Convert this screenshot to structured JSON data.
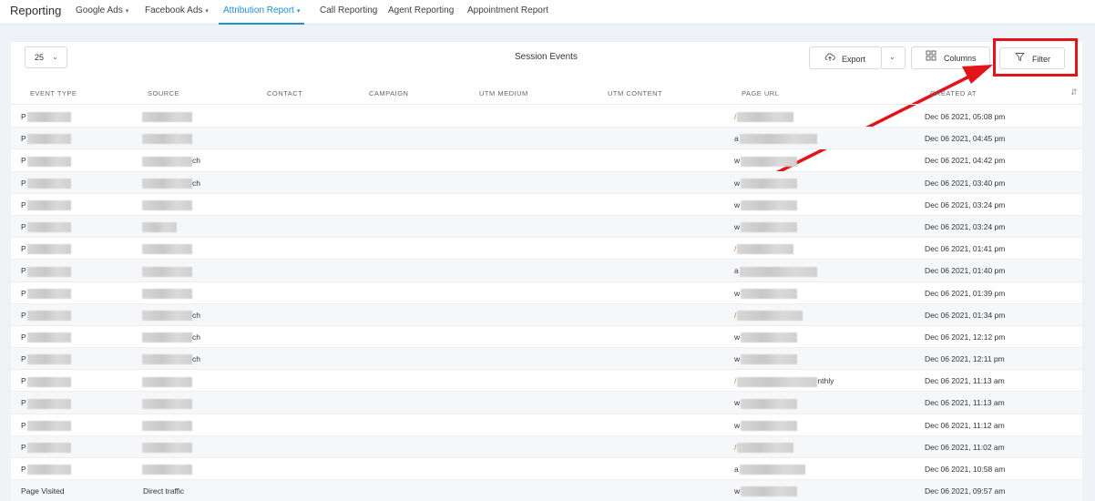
{
  "nav": {
    "title": "Reporting",
    "items": [
      {
        "label": "Google Ads",
        "chevron": "▾"
      },
      {
        "label": "Facebook Ads",
        "chevron": "▾"
      },
      {
        "label": "Attribution Report",
        "chevron": "▾"
      },
      {
        "label": "Call Reporting"
      },
      {
        "label": "Agent Reporting"
      },
      {
        "label": "Appointment Report"
      }
    ]
  },
  "toolbar": {
    "page_size": "25",
    "title": "Session Events",
    "export_label": "Export",
    "columns_label": "Columns",
    "filter_label": "Filter"
  },
  "table": {
    "columns": [
      "EVENT TYPE",
      "SOURCE",
      "CONTACT",
      "CAMPAIGN",
      "UTM MEDIUM",
      "UTM CONTENT",
      "PAGE URL",
      "CREATED AT"
    ],
    "rows": [
      {
        "type_prefix": "P",
        "src_suffix": "",
        "url_prefix": "/",
        "url_suffix": "",
        "created": "Dec 06 2021, 05:08 pm"
      },
      {
        "type_prefix": "P",
        "src_suffix": "",
        "url_prefix": "a",
        "url_suffix": "",
        "created": "Dec 06 2021, 04:45 pm"
      },
      {
        "type_prefix": "P",
        "src_suffix": "ch",
        "url_prefix": "w",
        "url_suffix": "",
        "created": "Dec 06 2021, 04:42 pm"
      },
      {
        "type_prefix": "P",
        "src_suffix": "ch",
        "url_prefix": "w",
        "url_suffix": "",
        "created": "Dec 06 2021, 03:40 pm"
      },
      {
        "type_prefix": "P",
        "src_suffix": "",
        "url_prefix": "w",
        "url_suffix": "",
        "created": "Dec 06 2021, 03:24 pm"
      },
      {
        "type_prefix": "P",
        "src_suffix": "",
        "url_prefix": "w",
        "url_suffix": "",
        "created": "Dec 06 2021, 03:24 pm"
      },
      {
        "type_prefix": "P",
        "src_suffix": "",
        "url_prefix": "/",
        "url_suffix": "",
        "created": "Dec 06 2021, 01:41 pm"
      },
      {
        "type_prefix": "P",
        "src_suffix": "",
        "url_prefix": "a",
        "url_suffix": "",
        "created": "Dec 06 2021, 01:40 pm"
      },
      {
        "type_prefix": "P",
        "src_suffix": "",
        "url_prefix": "w",
        "url_suffix": "",
        "created": "Dec 06 2021, 01:39 pm"
      },
      {
        "type_prefix": "P",
        "src_suffix": "ch",
        "url_prefix": "/",
        "url_suffix": "",
        "created": "Dec 06 2021, 01:34 pm"
      },
      {
        "type_prefix": "P",
        "src_suffix": "ch",
        "url_prefix": "w",
        "url_suffix": "",
        "created": "Dec 06 2021, 12:12 pm"
      },
      {
        "type_prefix": "P",
        "src_suffix": "ch",
        "url_prefix": "w",
        "url_suffix": "",
        "created": "Dec 06 2021, 12:11 pm"
      },
      {
        "type_prefix": "P",
        "src_suffix": "",
        "url_prefix": "/",
        "url_suffix": "nthly",
        "created": "Dec 06 2021, 11:13 am"
      },
      {
        "type_prefix": "P",
        "src_suffix": "",
        "url_prefix": "w",
        "url_suffix": "",
        "created": "Dec 06 2021, 11:13 am"
      },
      {
        "type_prefix": "P",
        "src_suffix": "",
        "url_prefix": "w",
        "url_suffix": "",
        "created": "Dec 06 2021, 11:12 am"
      },
      {
        "type_prefix": "P",
        "src_suffix": "",
        "url_prefix": "/",
        "url_suffix": "",
        "created": "Dec 06 2021, 11:02 am"
      },
      {
        "type_prefix": "P",
        "src_suffix": "",
        "url_prefix": "a",
        "url_suffix": "",
        "created": "Dec 06 2021, 10:58 am"
      },
      {
        "type_prefix": "Page Visited",
        "src_suffix": "Direct traffic",
        "url_prefix": "w",
        "url_suffix": "",
        "created": "Dec 06 2021, 09:57 am",
        "clear": true
      }
    ]
  },
  "colors": {
    "accent": "#1f8fd1",
    "highlight": "#e1141a"
  },
  "icons": {
    "export": "cloud-upload-icon",
    "columns": "grid-icon",
    "filter": "funnel-icon",
    "sort": "sort-icon"
  }
}
